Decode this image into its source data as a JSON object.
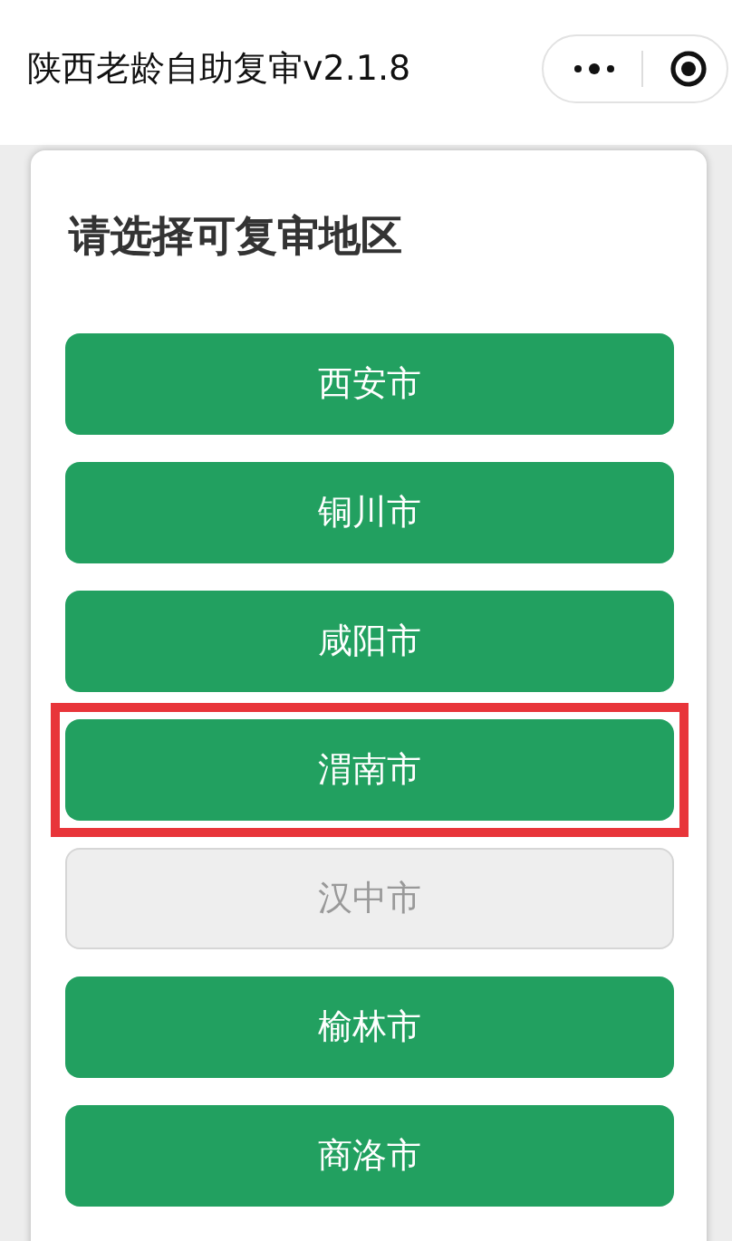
{
  "nav_bar": {
    "title": "陕西老龄自助复审v2.1.8"
  },
  "card": {
    "heading": "请选择可复审地区",
    "cities": [
      {
        "label": "西安市",
        "disabled": false,
        "highlighted": false
      },
      {
        "label": "铜川市",
        "disabled": false,
        "highlighted": false
      },
      {
        "label": "咸阳市",
        "disabled": false,
        "highlighted": false
      },
      {
        "label": "渭南市",
        "disabled": false,
        "highlighted": true
      },
      {
        "label": "汉中市",
        "disabled": true,
        "highlighted": false
      },
      {
        "label": "榆林市",
        "disabled": false,
        "highlighted": false
      },
      {
        "label": "商洛市",
        "disabled": false,
        "highlighted": false
      }
    ]
  }
}
